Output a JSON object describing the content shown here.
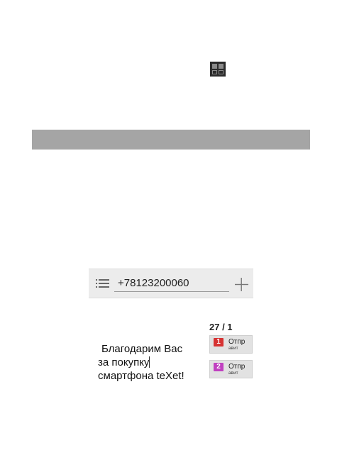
{
  "icons": {
    "apps_grid": "apps-grid-icon",
    "list": "list-icon",
    "plus": "plus-icon"
  },
  "recipient": {
    "value": "+78123200060"
  },
  "counter": "27 / 1",
  "message": {
    "line1": "Благодарим Вас",
    "line2": "за покупку",
    "line3": "смартфона teXet!"
  },
  "send_buttons": [
    {
      "sim": "1",
      "label_top": "Отпр",
      "label_bottom": "авит",
      "color": "#d63232"
    },
    {
      "sim": "2",
      "label_top": "Отпр",
      "label_bottom": "авит",
      "color": "#c040c0"
    }
  ],
  "colors": {
    "gray_bar": "#a5a5a5",
    "recipient_bar": "#ececec"
  }
}
